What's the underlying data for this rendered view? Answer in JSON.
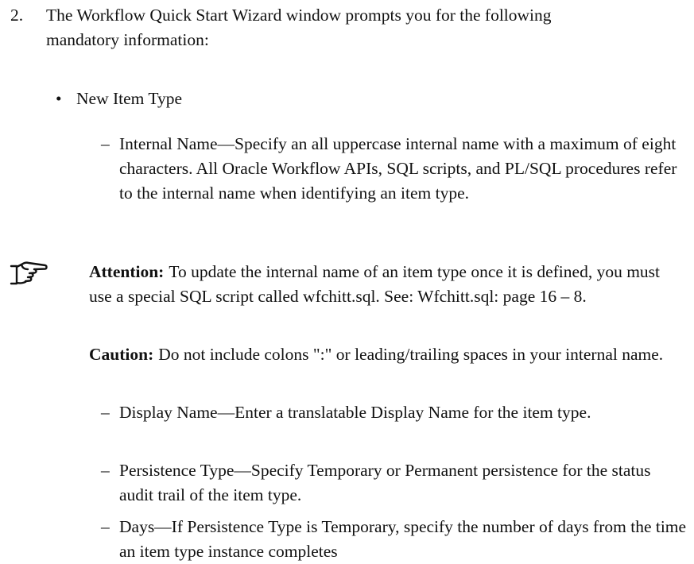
{
  "step": {
    "number": "2.",
    "text": "The Workflow Quick Start Wizard window prompts you for the following mandatory information:"
  },
  "bullet": {
    "symbol": "•",
    "text": "New Item Type"
  },
  "dash_symbol": "–",
  "internal_name": {
    "text": "Internal Name—Specify an all uppercase internal name with a maximum of eight characters.  All Oracle Workflow APIs, SQL scripts, and PL/SQL procedures refer to the internal name when identifying an item type."
  },
  "attention": {
    "icon": "pointing-hand-icon",
    "label": "Attention:",
    "text": "To update the internal name of an item type once it is defined, you must use a special SQL script called wfchitt.sql. See: Wfchitt.sql: page 16 – 8."
  },
  "caution": {
    "label": "Caution:",
    "text": "Do not include colons \":\" or leading/trailing spaces in your internal name."
  },
  "display_name": {
    "text": "Display Name—Enter a translatable Display Name for the item type."
  },
  "persistence_type": {
    "text": "Persistence Type—Specify Temporary or Permanent persistence for the status audit trail of the item type."
  },
  "days": {
    "text": "Days—If Persistence Type is Temporary, specify the number of days from the time an item type instance completes"
  }
}
